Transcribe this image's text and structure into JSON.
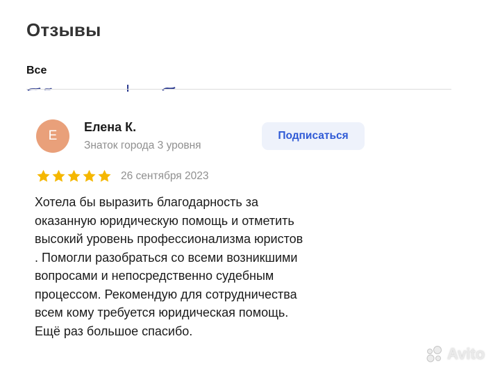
{
  "header": {
    "title": "Отзывы"
  },
  "tabs": {
    "all_label": "Все"
  },
  "review": {
    "avatar_letter": "Е",
    "author_name": "Елена К.",
    "author_level": "Знаток города 3 уровня",
    "subscribe_label": "Подписаться",
    "rating": 5,
    "date": "26 сентября 2023",
    "text_lines": [
      "Хотела бы выразить благодарность за",
      "оказанную юридическую помощь и отметить",
      "высокий уровень профессионализма юристов",
      ". Помогли разобраться со всеми возникшими",
      "вопросами и непосредственно судебным",
      "процессом. Рекомендую для сотрудничества",
      "всем кому требуется юридическая помощь.",
      "Ещё раз большое спасибо."
    ]
  },
  "watermark": {
    "text": "Avito",
    "icon": "avito-dots-icon"
  },
  "colors": {
    "avatar_bg": "#e9a07a",
    "star": "#f5b700",
    "subscribe_bg": "#eef2fb",
    "subscribe_text": "#2f5ad6",
    "muted_text": "#8f8f8f"
  }
}
